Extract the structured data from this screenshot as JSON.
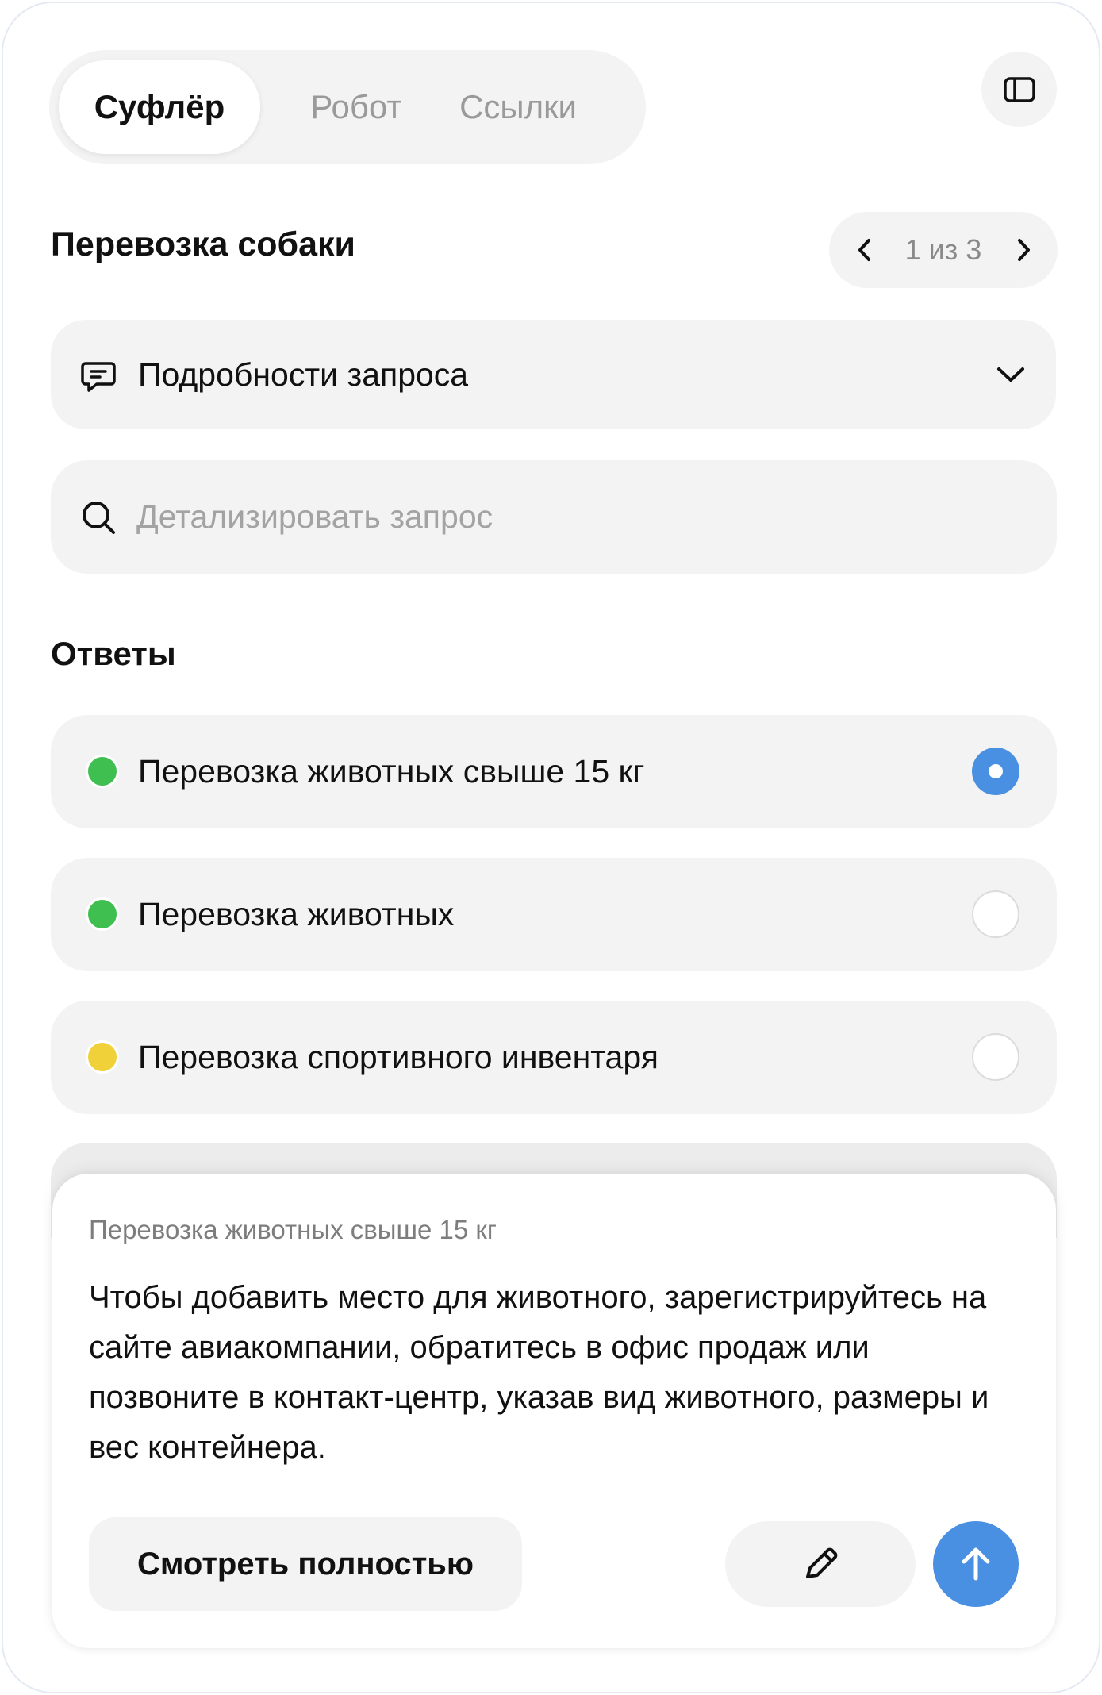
{
  "tabs": [
    {
      "label": "Суфлёр",
      "active": true
    },
    {
      "label": "Робот",
      "active": false
    },
    {
      "label": "Ссылки",
      "active": false
    }
  ],
  "panel_toggle_icon": "sidebar-panel-icon",
  "request": {
    "title": "Перевозка собаки",
    "pager": {
      "text": "1 из 3",
      "current": 1,
      "total": 3
    }
  },
  "details": {
    "label": "Подробности запроса",
    "icon": "message-icon",
    "toggle_icon": "chevron-down-icon"
  },
  "search": {
    "placeholder": "Детализировать запрос",
    "value": "",
    "icon": "search-icon"
  },
  "answers_title": "Ответы",
  "answers": [
    {
      "label": "Перевозка животных свыше 15 кг",
      "status_color": "#3fbf4f",
      "selected": true
    },
    {
      "label": "Перевозка животных",
      "status_color": "#3fbf4f",
      "selected": false
    },
    {
      "label": "Перевозка спортивного инвентаря",
      "status_color": "#f0d13a",
      "selected": false
    }
  ],
  "preview": {
    "subtitle": "Перевозка животных свыше 15 кг",
    "text": "Чтобы добавить место для животного, зарегистрируйтесь на сайте авиакомпании, обратитесь в офис продаж или позвоните в контакт-центр, указав вид животного, размеры и вес контейнера.",
    "view_full_label": "Смотреть полностью",
    "edit_icon": "pencil-icon",
    "send_icon": "arrow-up-icon"
  },
  "colors": {
    "accent": "#4a90e2",
    "surface": "#f3f3f3",
    "frame_border": "#e4e9f2"
  }
}
